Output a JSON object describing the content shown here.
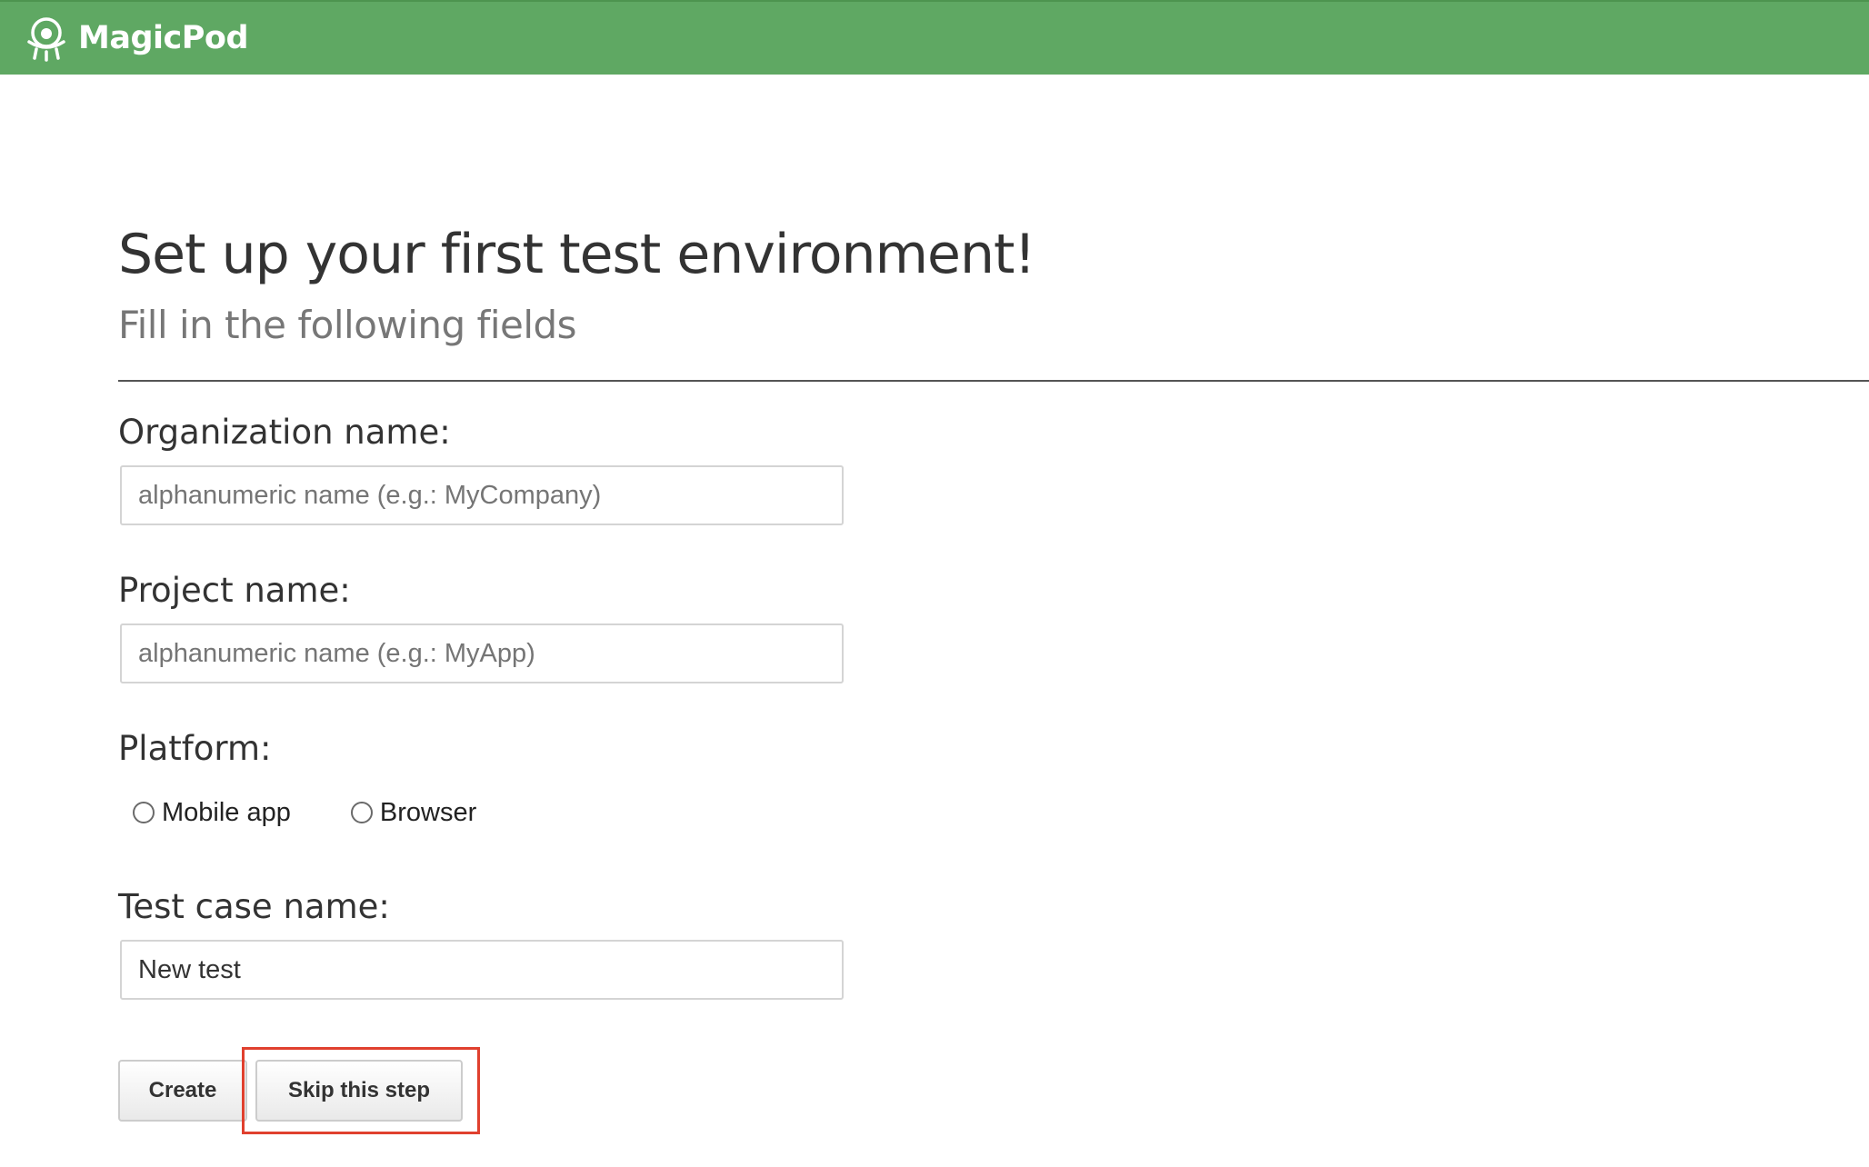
{
  "header": {
    "brand": "MagicPod",
    "logo_icon": "robot-ufo-icon",
    "background_color": "#5fa863"
  },
  "main": {
    "title": "Set up your first test environment!",
    "subtitle": "Fill in the following fields"
  },
  "form": {
    "organization": {
      "label": "Organization name:",
      "value": "",
      "placeholder": "alphanumeric name (e.g.: MyCompany)"
    },
    "project": {
      "label": "Project name:",
      "value": "",
      "placeholder": "alphanumeric name (e.g.: MyApp)"
    },
    "platform": {
      "label": "Platform:",
      "options": [
        {
          "label": "Mobile app",
          "selected": false
        },
        {
          "label": "Browser",
          "selected": false
        }
      ]
    },
    "test_case": {
      "label": "Test case name:",
      "value": "New test",
      "placeholder": ""
    }
  },
  "buttons": {
    "create_label": "Create",
    "skip_label": "Skip this step"
  },
  "annotation": {
    "highlight_color": "#e0402e",
    "highlighted": "skip-button"
  }
}
